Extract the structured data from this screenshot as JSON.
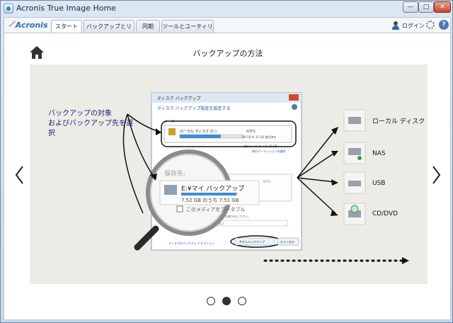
{
  "window": {
    "title": "Acronis True Image Home"
  },
  "brand": {
    "logo_text": "Acronis"
  },
  "tabs": [
    {
      "label": "スタート",
      "active": true
    },
    {
      "label": "バックアップとリカバリ",
      "active": false
    },
    {
      "label": "同期",
      "active": false
    },
    {
      "label": "ツールとユーティリティ",
      "active": false
    }
  ],
  "header": {
    "login_label": "ログイン"
  },
  "main": {
    "page_title": "バックアップの方法",
    "callout_line1": "バックアップの対象",
    "callout_line2": "およびバックアップ先を選",
    "callout_line3": "択"
  },
  "dialog": {
    "title": "ディスク バックアップ",
    "subtitle": "ディスク バックアップ設定を設定する",
    "source_label": "ソース",
    "source_item": "ローカル ディスク (C:)",
    "source_fs": "NTFS",
    "source_size": "48 GB 中 31 GB 使用済み",
    "source_info": "合計ソース サイズ: 31 GB",
    "source_link": "他のパーティションの選択",
    "dest_label": "保存先:",
    "dest_item": "E:¥マイ バックアップ",
    "dest_fs": "NTFS",
    "dest_size": "7.52 GB のうち 7.51 GB",
    "dest_checkbox": "このメディアをブータブル",
    "dest_hint": "バックアップ先を選択し、そのファイル名をお確かめください。",
    "dest_path": "f:¥ubuntu¥My Backup.tib ディスク (C:)",
    "options_link": "ディスクのバックアップ オプション",
    "backup_now": "今すぐバックアップ",
    "cancel": "キャンセル"
  },
  "destinations": [
    {
      "label": "ローカル ディスク",
      "icon": "hard-disk-icon"
    },
    {
      "label": "NAS",
      "icon": "nas-icon"
    },
    {
      "label": "USB",
      "icon": "usb-drive-icon"
    },
    {
      "label": "CD/DVD",
      "icon": "optical-drive-icon"
    }
  ],
  "pagination": {
    "total": 3,
    "current": 2
  },
  "colors": {
    "accent": "#2d6fb0",
    "close": "#c7442a",
    "progress": "#3a8fd6"
  }
}
